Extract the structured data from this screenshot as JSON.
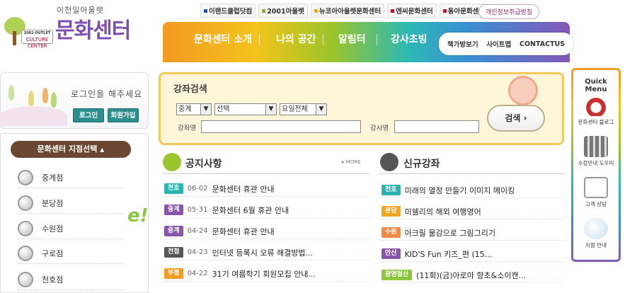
{
  "logo": {
    "sub": "이천일아울렛",
    "main": "문화센터",
    "badge_top": "2001·OUTLET",
    "badge_main": "CULTURE CENTER"
  },
  "family_links": [
    "이랜드클럽닷컴",
    "2001아울렛",
    "뉴코아아울렛문화센터",
    "엔씨문화센터",
    "동아문화센터"
  ],
  "privacy_link": "개인정보취급방침",
  "gnb": {
    "items": [
      "문화센터 소개",
      "나의 공간",
      "알림터",
      "강사초빙"
    ]
  },
  "util": [
    "책가방보기",
    "사이트맵",
    "CONTACTUS"
  ],
  "login": {
    "message": "로그인을 해주세요",
    "login_btn": "로그인",
    "join_btn": "회원가입"
  },
  "branch": {
    "select_label": "문화센터 지점선택",
    "items": [
      "중계점",
      "분당점",
      "수원점",
      "구로점",
      "천호점"
    ],
    "banner_fragment": "e!"
  },
  "search": {
    "title": "강좌검색",
    "branch_select": "중계",
    "category_select": "선택",
    "day_select": "요일전체",
    "course_label": "강좌명",
    "teacher_label": "강사명",
    "button": "검색",
    "button_arrow": "›"
  },
  "notice": {
    "title": "공지사항",
    "more": "▸ MORE",
    "items": [
      {
        "tag": "천호",
        "tag_color": "#2ab3b0",
        "date": "06-02",
        "text": "문화센터 휴관 안내"
      },
      {
        "tag": "중계",
        "tag_color": "#8855a8",
        "date": "05-31",
        "text": "문화센터 6월 휴관 안내"
      },
      {
        "tag": "중계",
        "tag_color": "#8855a8",
        "date": "04-24",
        "text": "문화센터 휴관 안내"
      },
      {
        "tag": "전점",
        "tag_color": "#555555",
        "date": "04-23",
        "text": "인터넷 등록시 오류 해결방법..."
      },
      {
        "tag": "부평",
        "tag_color": "#f39a21",
        "date": "04-22",
        "text": "31기 여름학기 회원모집 안내..."
      }
    ]
  },
  "new_course": {
    "title": "신규강좌",
    "items": [
      {
        "tag": "천호",
        "tag_color": "#2ab3b0",
        "text": "미래의 열정 만들기 이미지 메이킹"
      },
      {
        "tag": "분당",
        "tag_color": "#f3a51b",
        "text": "미쉘리의 해외 여행영어"
      },
      {
        "tag": "수원",
        "tag_color": "#f28a45",
        "text": "아크릴 물감으로 그림그리기"
      },
      {
        "tag": "안산",
        "tag_color": "#8855a8",
        "text": "KID'S Fun 키즈_편 (15..."
      },
      {
        "tag": "광명철산",
        "tag_color": "#8cc63f",
        "text": "(11회)(금)아로마 향초&소이캔..."
      }
    ]
  },
  "quick_menu": {
    "title": "Quick Menu",
    "items": [
      "문화센터 블로그",
      "수강안내 도우미",
      "고객 상담",
      "지점 안내"
    ]
  }
}
